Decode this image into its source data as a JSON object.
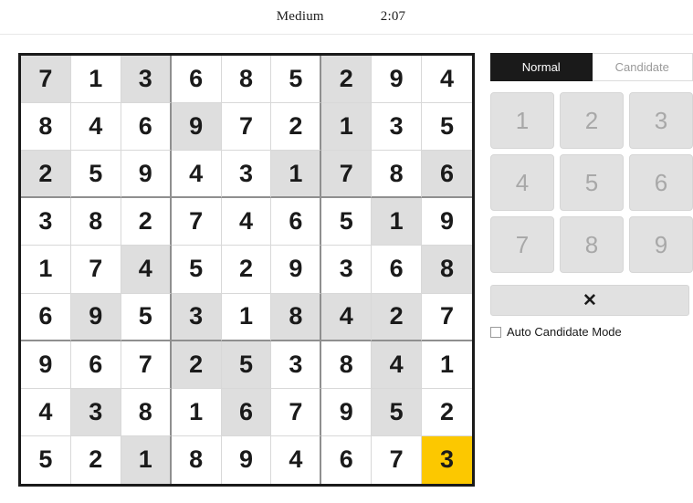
{
  "header": {
    "difficulty": "Medium",
    "timer": "2:07"
  },
  "board": {
    "rows": [
      [
        "7",
        "1",
        "3",
        "6",
        "8",
        "5",
        "2",
        "9",
        "4"
      ],
      [
        "8",
        "4",
        "6",
        "9",
        "7",
        "2",
        "1",
        "3",
        "5"
      ],
      [
        "2",
        "5",
        "9",
        "4",
        "3",
        "1",
        "7",
        "8",
        "6"
      ],
      [
        "3",
        "8",
        "2",
        "7",
        "4",
        "6",
        "5",
        "1",
        "9"
      ],
      [
        "1",
        "7",
        "4",
        "5",
        "2",
        "9",
        "3",
        "6",
        "8"
      ],
      [
        "6",
        "9",
        "5",
        "3",
        "1",
        "8",
        "4",
        "2",
        "7"
      ],
      [
        "9",
        "6",
        "7",
        "2",
        "5",
        "3",
        "8",
        "4",
        "1"
      ],
      [
        "4",
        "3",
        "8",
        "1",
        "6",
        "7",
        "9",
        "5",
        "2"
      ],
      [
        "5",
        "2",
        "1",
        "8",
        "9",
        "4",
        "6",
        "7",
        "3"
      ]
    ],
    "clues": [
      [
        true,
        false,
        true,
        false,
        false,
        false,
        true,
        false,
        false
      ],
      [
        false,
        false,
        false,
        true,
        false,
        false,
        true,
        false,
        false
      ],
      [
        true,
        false,
        false,
        false,
        false,
        true,
        true,
        false,
        true
      ],
      [
        false,
        false,
        false,
        false,
        false,
        false,
        false,
        true,
        false
      ],
      [
        false,
        false,
        true,
        false,
        false,
        false,
        false,
        false,
        true
      ],
      [
        false,
        true,
        false,
        true,
        false,
        true,
        true,
        true,
        false
      ],
      [
        false,
        false,
        false,
        true,
        true,
        false,
        false,
        true,
        false
      ],
      [
        false,
        true,
        false,
        false,
        true,
        false,
        false,
        true,
        false
      ],
      [
        false,
        false,
        true,
        false,
        false,
        false,
        false,
        false,
        false
      ]
    ],
    "selected": {
      "row": 8,
      "col": 8
    },
    "colors": {
      "clue_background": "#dedede",
      "selected_background": "#fcc800",
      "digit": "#1a1a1a",
      "outer_border": "#1a1a1a",
      "box_border": "#8f8f8f",
      "cell_border": "#d8d8d8"
    }
  },
  "panel": {
    "modes": [
      {
        "label": "Normal",
        "active": true
      },
      {
        "label": "Candidate",
        "active": false
      }
    ],
    "numbers": [
      "1",
      "2",
      "3",
      "4",
      "5",
      "6",
      "7",
      "8",
      "9"
    ],
    "erase_label": "✕",
    "auto_candidate_label": "Auto Candidate Mode",
    "auto_candidate_checked": false
  }
}
